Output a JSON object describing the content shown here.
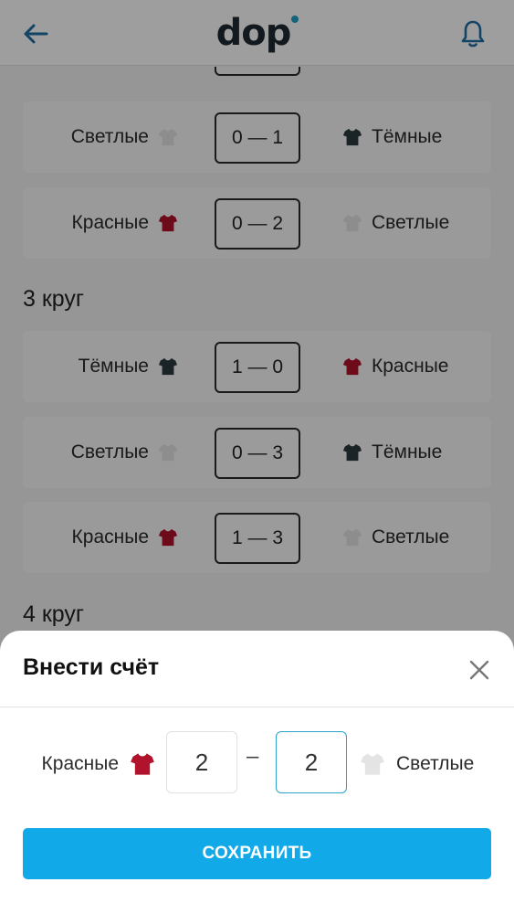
{
  "header": {
    "logo": "dop",
    "back_icon": "arrow-left-icon",
    "bell_icon": "bell-icon",
    "accent_color": "#1f6fa5"
  },
  "rounds": [
    {
      "title": "",
      "matches": [
        {
          "home": "Светлые",
          "home_color": "#e4e4e4",
          "score": "0 — 1",
          "away": "Тёмные",
          "away_color": "#2b3a3f"
        },
        {
          "home": "Красные",
          "home_color": "#b0132b",
          "score": "0 — 2",
          "away": "Светлые",
          "away_color": "#e4e4e4"
        }
      ]
    },
    {
      "title": "3 круг",
      "matches": [
        {
          "home": "Тёмные",
          "home_color": "#2b3a3f",
          "score": "1 — 0",
          "away": "Красные",
          "away_color": "#b0132b"
        },
        {
          "home": "Светлые",
          "home_color": "#e4e4e4",
          "score": "0 — 3",
          "away": "Тёмные",
          "away_color": "#2b3a3f"
        },
        {
          "home": "Красные",
          "home_color": "#b0132b",
          "score": "1 — 3",
          "away": "Светлые",
          "away_color": "#e4e4e4"
        }
      ]
    },
    {
      "title": "4 круг",
      "matches": []
    }
  ],
  "sheet": {
    "title": "Внести счёт",
    "close_icon": "close-icon",
    "home_team": "Красные",
    "home_color": "#b0132b",
    "away_team": "Светлые",
    "away_color": "#e4e4e4",
    "home_score": "2",
    "away_score": "2",
    "separator": "–",
    "save_label": "СОХРАНИТЬ",
    "save_color": "#12a9e8"
  }
}
